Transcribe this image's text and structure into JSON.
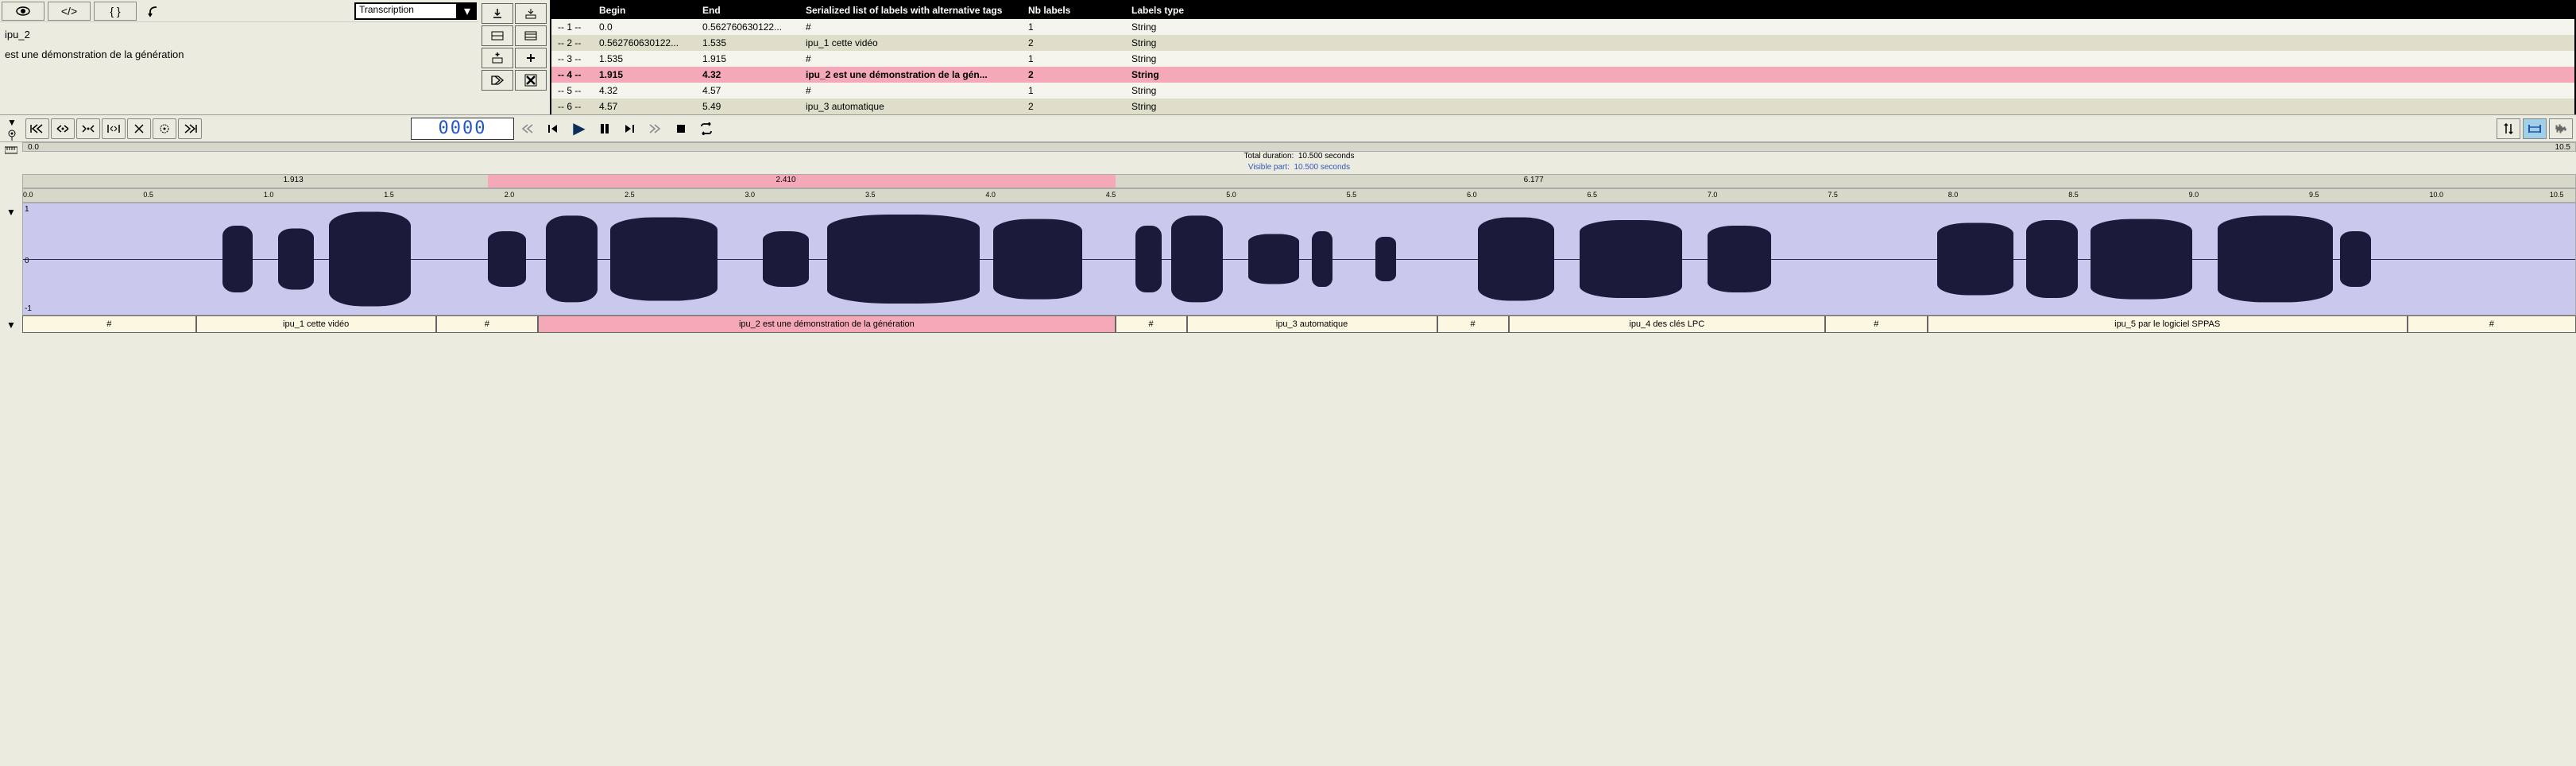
{
  "dropdown": {
    "label": "Transcription"
  },
  "info_panel": {
    "name": "ipu_2",
    "text": "est une démonstration de la génération"
  },
  "grid": {
    "headers": [
      "",
      "Begin",
      "End",
      "Serialized list of labels with alternative tags",
      "Nb labels",
      "Labels type"
    ],
    "rows": [
      {
        "idx": "-- 1 --",
        "begin": "0.0",
        "end": "0.562760630122...",
        "labels": "#",
        "nb": "1",
        "type": "String",
        "sel": false,
        "even": true
      },
      {
        "idx": "-- 2 --",
        "begin": "0.562760630122...",
        "end": "1.535",
        "labels": "ipu_1 cette vidéo",
        "nb": "2",
        "type": "String",
        "sel": false,
        "even": false
      },
      {
        "idx": "-- 3 --",
        "begin": "1.535",
        "end": "1.915",
        "labels": "#",
        "nb": "1",
        "type": "String",
        "sel": false,
        "even": true
      },
      {
        "idx": "-- 4 --",
        "begin": "1.915",
        "end": "4.32",
        "labels": "ipu_2 est une démonstration de la gén...",
        "nb": "2",
        "type": "String",
        "sel": true,
        "even": false
      },
      {
        "idx": "-- 5 --",
        "begin": "4.32",
        "end": "4.57",
        "labels": "#",
        "nb": "1",
        "type": "String",
        "sel": false,
        "even": true
      },
      {
        "idx": "-- 6 --",
        "begin": "4.57",
        "end": "5.49",
        "labels": "ipu_3 automatique",
        "nb": "2",
        "type": "String",
        "sel": false,
        "even": false
      }
    ]
  },
  "counter": {
    "value": "0000"
  },
  "time": {
    "start": "0.0",
    "end": "10.5",
    "total_label": "Total duration:",
    "total_value": "10.500 seconds",
    "visible_label": "Visible part:",
    "visible_value": "10.500 seconds",
    "sel_start_pct": 18.2,
    "sel_end_pct": 42.8,
    "sel_start": "1.913",
    "sel_mid": "2.410",
    "mark_right": "6.177",
    "mark_right_pct": 58.8,
    "ruler_ticks": [
      "0.0",
      "0.5",
      "1.0",
      "1.5",
      "2.0",
      "2.5",
      "3.0",
      "3.5",
      "4.0",
      "4.5",
      "5.0",
      "5.5",
      "6.0",
      "6.5",
      "7.0",
      "7.5",
      "8.0",
      "8.5",
      "9.0",
      "9.5",
      "10.0",
      "10.5"
    ]
  },
  "waveform": {
    "ylabels": {
      "top": "1",
      "mid": "0",
      "bot": "-1"
    },
    "bursts": [
      {
        "left": 7.8,
        "width": 1.2,
        "height": 60
      },
      {
        "left": 10.0,
        "width": 1.4,
        "height": 55
      },
      {
        "left": 12.0,
        "width": 3.2,
        "height": 85
      },
      {
        "left": 18.2,
        "width": 1.5,
        "height": 50
      },
      {
        "left": 20.5,
        "width": 2.0,
        "height": 78
      },
      {
        "left": 23.0,
        "width": 4.2,
        "height": 75
      },
      {
        "left": 29.0,
        "width": 1.8,
        "height": 50
      },
      {
        "left": 31.5,
        "width": 6.0,
        "height": 80
      },
      {
        "left": 38.0,
        "width": 3.5,
        "height": 72
      },
      {
        "left": 43.6,
        "width": 1.0,
        "height": 60
      },
      {
        "left": 45.0,
        "width": 2.0,
        "height": 78
      },
      {
        "left": 48.0,
        "width": 2.0,
        "height": 45
      },
      {
        "left": 50.5,
        "width": 0.8,
        "height": 50
      },
      {
        "left": 53.0,
        "width": 0.8,
        "height": 40
      },
      {
        "left": 57.0,
        "width": 3.0,
        "height": 75
      },
      {
        "left": 61.0,
        "width": 4.0,
        "height": 70
      },
      {
        "left": 66.0,
        "width": 2.5,
        "height": 60
      },
      {
        "left": 75.0,
        "width": 3.0,
        "height": 65
      },
      {
        "left": 78.5,
        "width": 2.0,
        "height": 70
      },
      {
        "left": 81.0,
        "width": 4.0,
        "height": 72
      },
      {
        "left": 86.0,
        "width": 4.5,
        "height": 78
      },
      {
        "left": 90.8,
        "width": 1.2,
        "height": 50
      }
    ]
  },
  "tier": {
    "cells": [
      {
        "label": "#",
        "width": 6.8,
        "sel": false
      },
      {
        "label": "ipu_1 cette vidéo",
        "width": 9.4,
        "sel": false
      },
      {
        "label": "#",
        "width": 4.0,
        "sel": false
      },
      {
        "label": "ipu_2 est une démonstration de la génération",
        "width": 22.6,
        "sel": true
      },
      {
        "label": "#",
        "width": 2.8,
        "sel": false
      },
      {
        "label": "ipu_3 automatique",
        "width": 9.8,
        "sel": false
      },
      {
        "label": "#",
        "width": 2.8,
        "sel": false
      },
      {
        "label": "ipu_4 des clés LPC",
        "width": 12.4,
        "sel": false
      },
      {
        "label": "#",
        "width": 4.0,
        "sel": false
      },
      {
        "label": "ipu_5 par le logiciel SPPAS",
        "width": 18.8,
        "sel": false
      },
      {
        "label": "#",
        "width": 6.6,
        "sel": false
      }
    ]
  }
}
